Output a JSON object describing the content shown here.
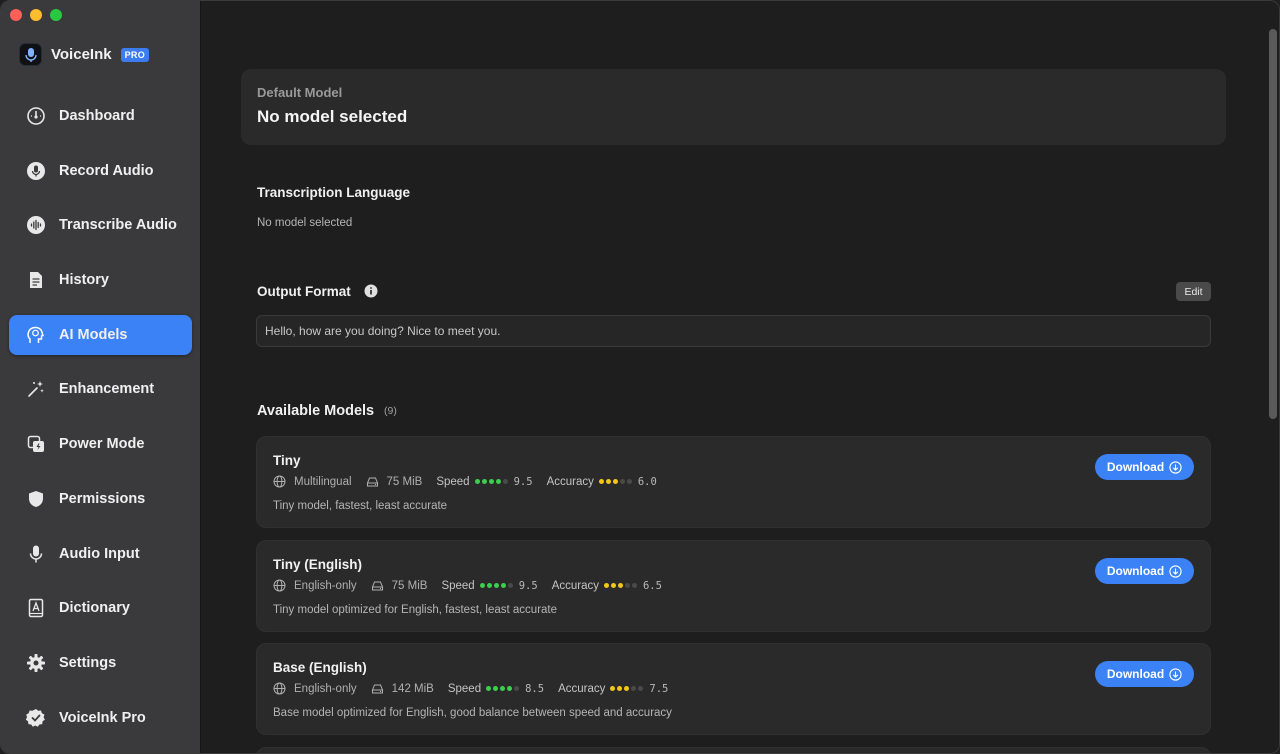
{
  "app": {
    "name": "VoiceInk",
    "badge": "PRO"
  },
  "sidebar": {
    "items": [
      {
        "label": "Dashboard",
        "icon": "gauge-icon",
        "active": false
      },
      {
        "label": "Record Audio",
        "icon": "mic-circle-icon",
        "active": false
      },
      {
        "label": "Transcribe Audio",
        "icon": "waveform-circle-icon",
        "active": false
      },
      {
        "label": "History",
        "icon": "document-icon",
        "active": false
      },
      {
        "label": "AI Models",
        "icon": "brain-head-icon",
        "active": true
      },
      {
        "label": "Enhancement",
        "icon": "sparkles-wand-icon",
        "active": false
      },
      {
        "label": "Power Mode",
        "icon": "power-mode-icon",
        "active": false
      },
      {
        "label": "Permissions",
        "icon": "shield-icon",
        "active": false
      },
      {
        "label": "Audio Input",
        "icon": "microphone-icon",
        "active": false
      },
      {
        "label": "Dictionary",
        "icon": "dictionary-icon",
        "active": false
      },
      {
        "label": "Settings",
        "icon": "gear-icon",
        "active": false
      },
      {
        "label": "VoiceInk Pro",
        "icon": "checkmark-seal-icon",
        "active": false
      }
    ]
  },
  "default_model": {
    "label": "Default Model",
    "value": "No model selected"
  },
  "transcription_language": {
    "label": "Transcription Language",
    "value": "No model selected"
  },
  "output_format": {
    "label": "Output Format",
    "edit_label": "Edit",
    "sample": "Hello, how are you doing? Nice to meet you."
  },
  "available_models": {
    "title": "Available Models",
    "count": "(9)",
    "speed_label": "Speed",
    "accuracy_label": "Accuracy",
    "download_label": "Download",
    "items": [
      {
        "name": "Tiny",
        "language": "Multilingual",
        "size": "75 MiB",
        "speed": "9.5",
        "speed_dots": 4,
        "accuracy": "6.0",
        "accuracy_dots": 3,
        "description": "Tiny model, fastest, least accurate"
      },
      {
        "name": "Tiny (English)",
        "language": "English-only",
        "size": "75 MiB",
        "speed": "9.5",
        "speed_dots": 4,
        "accuracy": "6.5",
        "accuracy_dots": 3,
        "description": "Tiny model optimized for English, fastest, least accurate"
      },
      {
        "name": "Base (English)",
        "language": "English-only",
        "size": "142 MiB",
        "speed": "8.5",
        "speed_dots": 4,
        "accuracy": "7.5",
        "accuracy_dots": 3,
        "description": "Base model optimized for English, good balance between speed and accuracy"
      }
    ]
  },
  "colors": {
    "accent": "#3b82f6",
    "speed_dot": "#3ccf4e",
    "accuracy_dot": "#f5c518"
  }
}
